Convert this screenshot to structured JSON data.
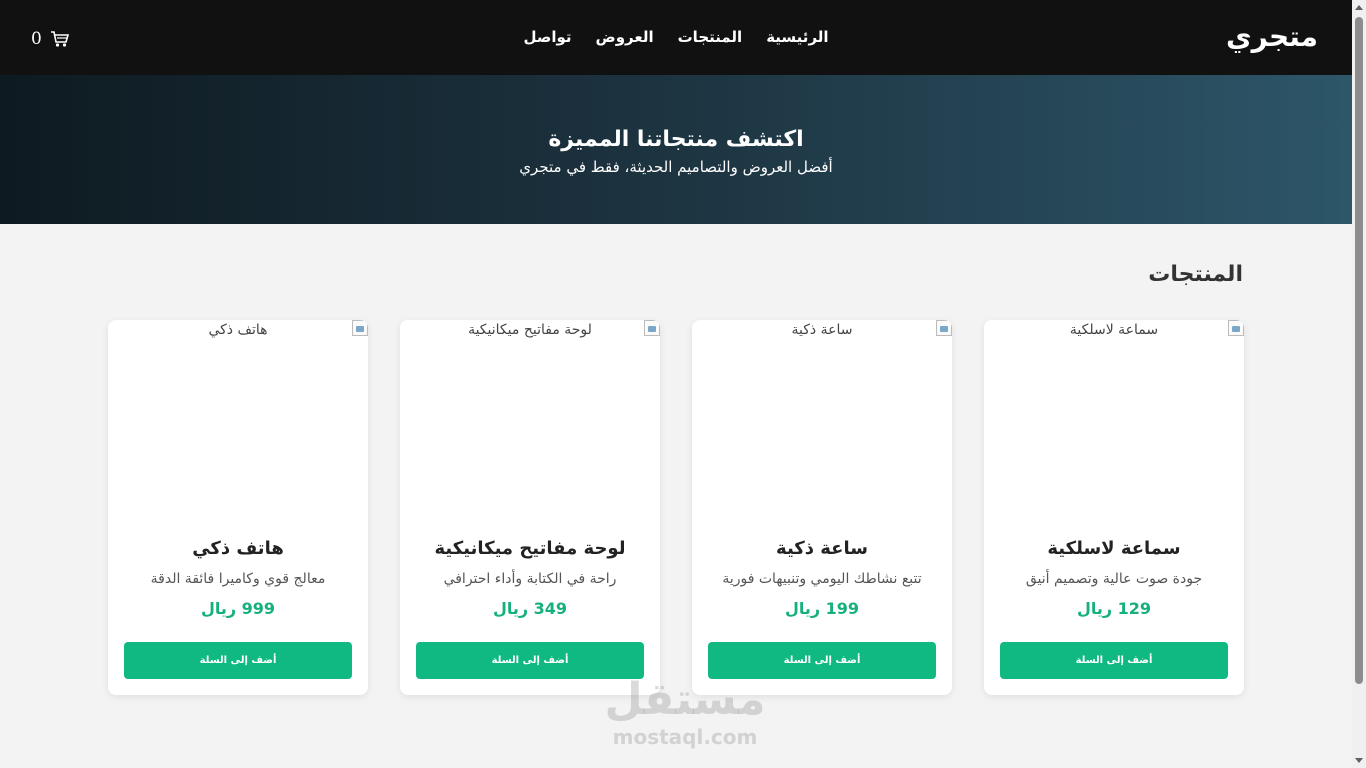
{
  "header": {
    "logo": "متجري",
    "nav": [
      "الرئيسية",
      "المنتجات",
      "العروض",
      "تواصل"
    ],
    "cart_count": "0"
  },
  "hero": {
    "title": "اكتشف منتجاتنا المميزة",
    "subtitle": "أفضل العروض والتصاميم الحديثة، فقط في متجري"
  },
  "products_section": {
    "title": "المنتجات",
    "add_label": "أضف إلى السلة",
    "items": [
      {
        "image_alt": "سماعة لاسلكية",
        "name": "سماعة لاسلكية",
        "description": "جودة صوت عالية وتصميم أنيق",
        "price": "129 ريال"
      },
      {
        "image_alt": "ساعة ذكية",
        "name": "ساعة ذكية",
        "description": "تتبع نشاطك اليومي وتنبيهات فورية",
        "price": "199 ريال"
      },
      {
        "image_alt": "لوحة مفاتيح ميكانيكية",
        "name": "لوحة مفاتيح ميكانيكية",
        "description": "راحة في الكتابة وأداء احترافي",
        "price": "349 ريال"
      },
      {
        "image_alt": "هاتف ذكي",
        "name": "هاتف ذكي",
        "description": "معالج قوي وكاميرا فائقة الدقة",
        "price": "999 ريال"
      }
    ]
  },
  "watermark": {
    "logo": "مستقل",
    "url": "mostaql.com"
  },
  "colors": {
    "navbar": "#111111",
    "accent": "#10b981",
    "price": "#16b07e"
  }
}
